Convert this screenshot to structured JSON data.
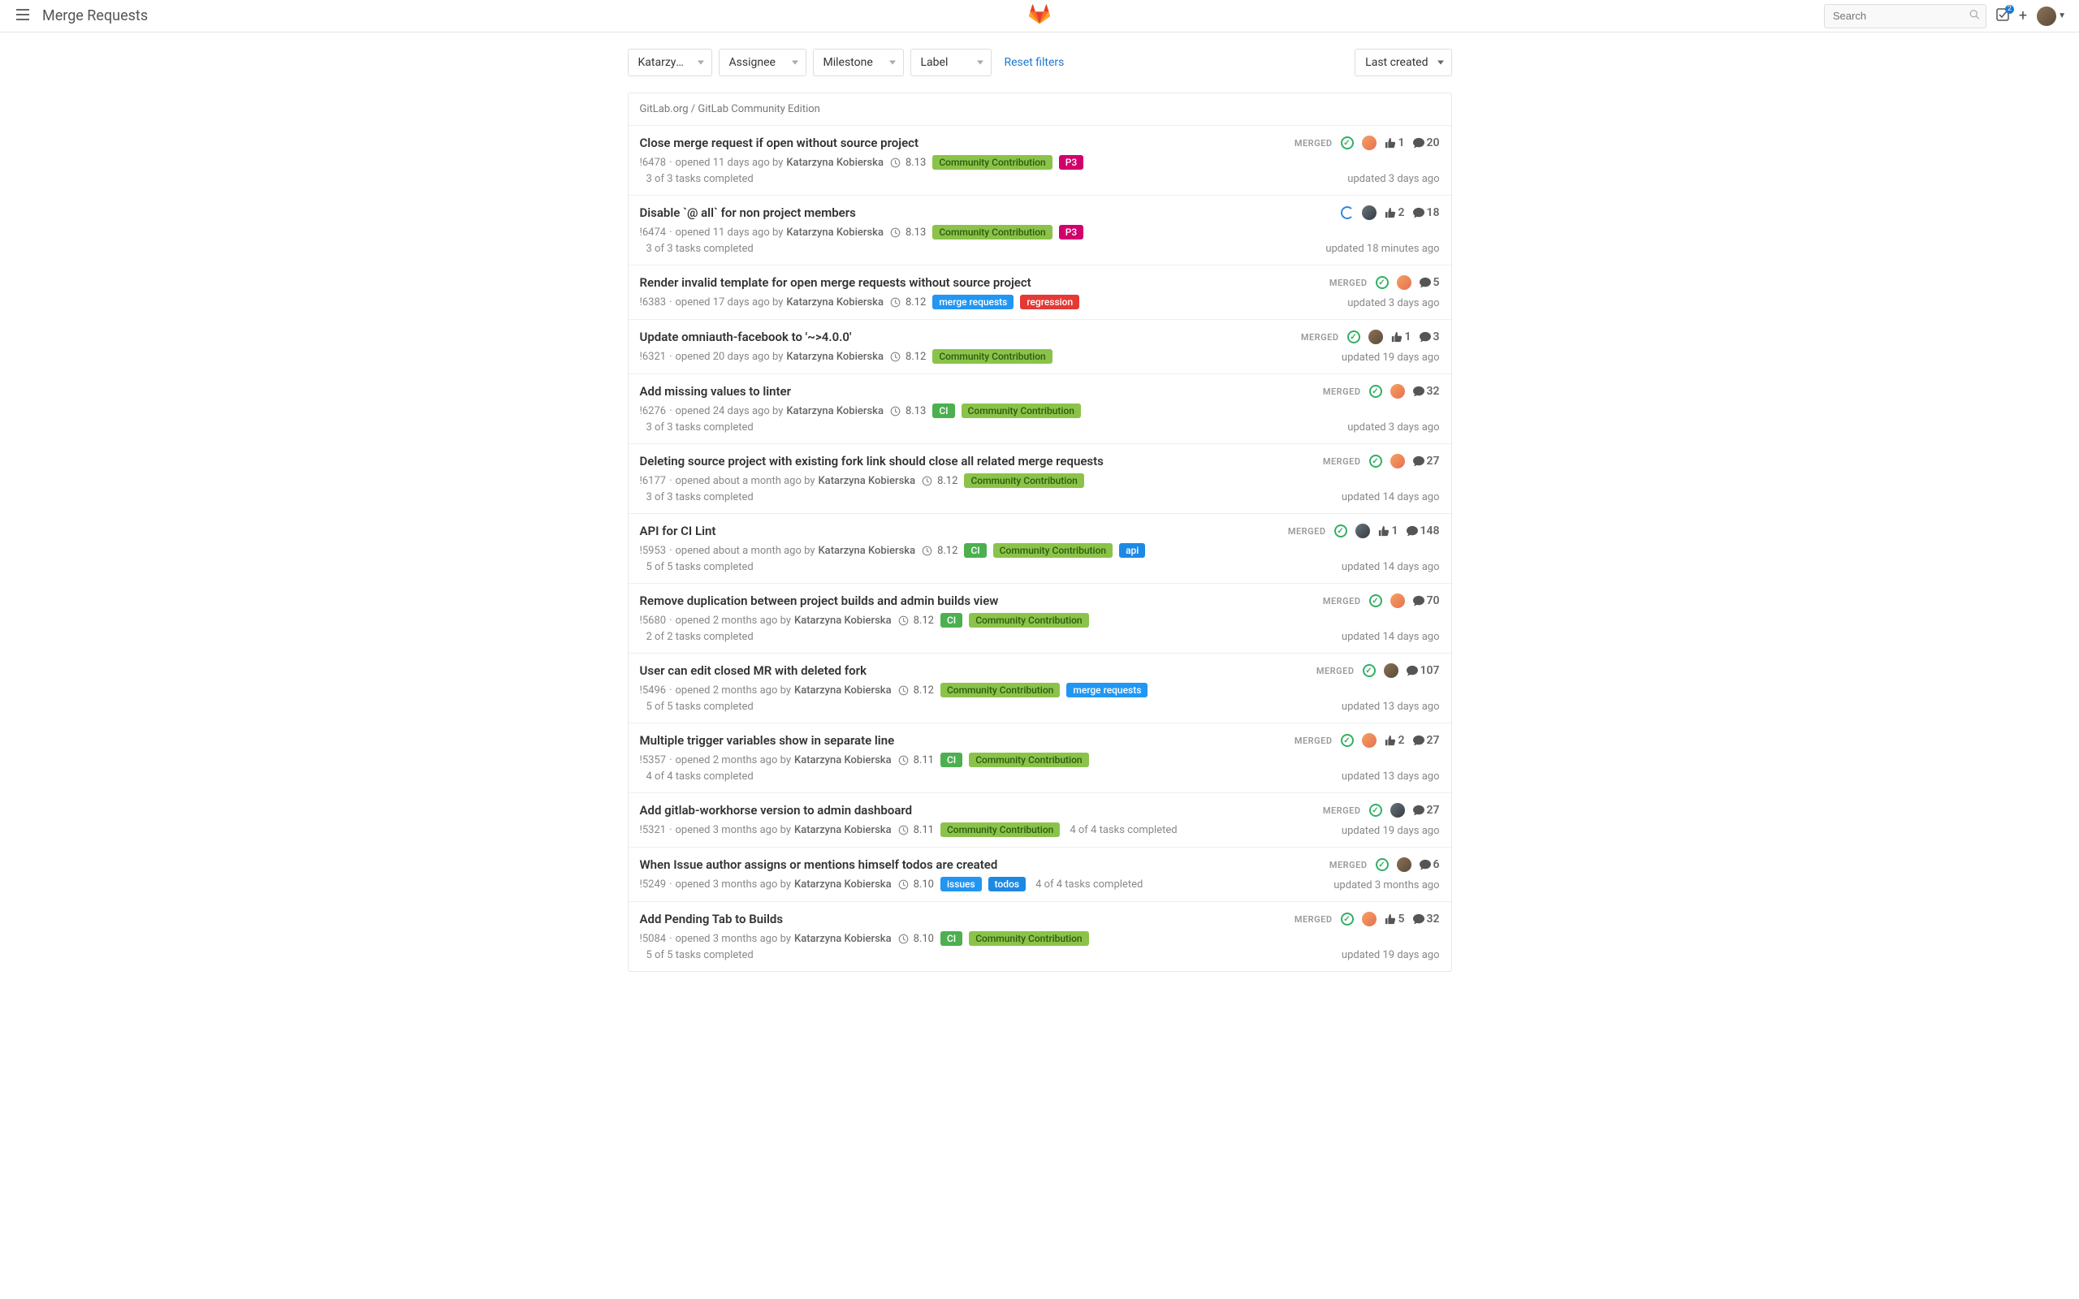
{
  "header": {
    "title": "Merge Requests",
    "search_placeholder": "Search",
    "notification_count": "2"
  },
  "filters": {
    "author": "Katarzyna Ko…",
    "assignee": "Assignee",
    "milestone": "Milestone",
    "label": "Label",
    "reset": "Reset filters",
    "sort": "Last created"
  },
  "project_path": "GitLab.org / GitLab Community Edition",
  "merge_requests": [
    {
      "title": "Close merge request if open without source project",
      "ref": "!6478",
      "opened": "opened 11 days ago by",
      "author": "Katarzyna Kobierska",
      "milestone": "8.13",
      "labels": [
        {
          "t": "Community Contribution",
          "c": "community"
        },
        {
          "t": "P3",
          "c": "p3"
        }
      ],
      "tasks": "3 of 3 tasks completed",
      "updated": "updated 3 days ago",
      "status": "MERGED",
      "ci": "success",
      "avatar": "ava-1",
      "thumbs": "1",
      "comments": "20"
    },
    {
      "title": "Disable `@ all` for non project members",
      "ref": "!6474",
      "opened": "opened 11 days ago by",
      "author": "Katarzyna Kobierska",
      "milestone": "8.13",
      "labels": [
        {
          "t": "Community Contribution",
          "c": "community"
        },
        {
          "t": "P3",
          "c": "p3"
        }
      ],
      "tasks": "3 of 3 tasks completed",
      "updated": "updated 18 minutes ago",
      "status": "",
      "ci": "running",
      "avatar": "ava-2",
      "thumbs": "2",
      "comments": "18"
    },
    {
      "title": "Render invalid template for open merge requests without source project",
      "ref": "!6383",
      "opened": "opened 17 days ago by",
      "author": "Katarzyna Kobierska",
      "milestone": "8.12",
      "labels": [
        {
          "t": "merge requests",
          "c": "merge-requests"
        },
        {
          "t": "regression",
          "c": "regression"
        }
      ],
      "tasks": "",
      "updated": "updated 3 days ago",
      "status": "MERGED",
      "ci": "success",
      "avatar": "ava-1",
      "thumbs": "",
      "comments": "5"
    },
    {
      "title": "Update omniauth-facebook to '~>4.0.0'",
      "ref": "!6321",
      "opened": "opened 20 days ago by",
      "author": "Katarzyna Kobierska",
      "milestone": "8.12",
      "labels": [
        {
          "t": "Community Contribution",
          "c": "community"
        }
      ],
      "tasks": "",
      "updated": "updated 19 days ago",
      "status": "MERGED",
      "ci": "success",
      "avatar": "ava-3",
      "thumbs": "1",
      "comments": "3"
    },
    {
      "title": "Add missing values to linter",
      "ref": "!6276",
      "opened": "opened 24 days ago by",
      "author": "Katarzyna Kobierska",
      "milestone": "8.13",
      "labels": [
        {
          "t": "CI",
          "c": "ci"
        },
        {
          "t": "Community Contribution",
          "c": "community"
        }
      ],
      "tasks": "3 of 3 tasks completed",
      "updated": "updated 3 days ago",
      "status": "MERGED",
      "ci": "success",
      "avatar": "ava-1",
      "thumbs": "",
      "comments": "32"
    },
    {
      "title": "Deleting source project with existing fork link should close all related merge requests",
      "ref": "!6177",
      "opened": "opened about a month ago by",
      "author": "Katarzyna Kobierska",
      "milestone": "8.12",
      "labels": [
        {
          "t": "Community Contribution",
          "c": "community"
        }
      ],
      "tasks": "3 of 3 tasks completed",
      "updated": "updated 14 days ago",
      "status": "MERGED",
      "ci": "success",
      "avatar": "ava-1",
      "thumbs": "",
      "comments": "27"
    },
    {
      "title": "API for CI Lint",
      "ref": "!5953",
      "opened": "opened about a month ago by",
      "author": "Katarzyna Kobierska",
      "milestone": "8.12",
      "labels": [
        {
          "t": "CI",
          "c": "ci"
        },
        {
          "t": "Community Contribution",
          "c": "community"
        },
        {
          "t": "api",
          "c": "api"
        }
      ],
      "tasks": "5 of 5 tasks completed",
      "updated": "updated 14 days ago",
      "status": "MERGED",
      "ci": "success",
      "avatar": "ava-2",
      "thumbs": "1",
      "comments": "148"
    },
    {
      "title": "Remove duplication between project builds and admin builds view",
      "ref": "!5680",
      "opened": "opened 2 months ago by",
      "author": "Katarzyna Kobierska",
      "milestone": "8.12",
      "labels": [
        {
          "t": "CI",
          "c": "ci"
        },
        {
          "t": "Community Contribution",
          "c": "community"
        }
      ],
      "tasks": "2 of 2 tasks completed",
      "updated": "updated 14 days ago",
      "status": "MERGED",
      "ci": "success",
      "avatar": "ava-1",
      "thumbs": "",
      "comments": "70"
    },
    {
      "title": "User can edit closed MR with deleted fork",
      "ref": "!5496",
      "opened": "opened 2 months ago by",
      "author": "Katarzyna Kobierska",
      "milestone": "8.12",
      "labels": [
        {
          "t": "Community Contribution",
          "c": "community"
        },
        {
          "t": "merge requests",
          "c": "merge-requests"
        }
      ],
      "tasks": "5 of 5 tasks completed",
      "updated": "updated 13 days ago",
      "status": "MERGED",
      "ci": "success",
      "avatar": "ava-3",
      "thumbs": "",
      "comments": "107"
    },
    {
      "title": "Multiple trigger variables show in separate line",
      "ref": "!5357",
      "opened": "opened 2 months ago by",
      "author": "Katarzyna Kobierska",
      "milestone": "8.11",
      "labels": [
        {
          "t": "CI",
          "c": "ci"
        },
        {
          "t": "Community Contribution",
          "c": "community"
        }
      ],
      "tasks": "4 of 4 tasks completed",
      "updated": "updated 13 days ago",
      "status": "MERGED",
      "ci": "success",
      "avatar": "ava-1",
      "thumbs": "2",
      "comments": "27"
    },
    {
      "title": "Add gitlab-workhorse version to admin dashboard",
      "ref": "!5321",
      "opened": "opened 3 months ago by",
      "author": "Katarzyna Kobierska",
      "milestone": "8.11",
      "labels": [
        {
          "t": "Community Contribution",
          "c": "community"
        }
      ],
      "tasks": "4 of 4 tasks completed",
      "updated": "updated 19 days ago",
      "status": "MERGED",
      "ci": "success",
      "avatar": "ava-2",
      "thumbs": "",
      "comments": "27"
    },
    {
      "title": "When Issue author assigns or mentions himself todos are created",
      "ref": "!5249",
      "opened": "opened 3 months ago by",
      "author": "Katarzyna Kobierska",
      "milestone": "8.10",
      "labels": [
        {
          "t": "issues",
          "c": "issues"
        },
        {
          "t": "todos",
          "c": "todos"
        }
      ],
      "tasks": "4 of 4 tasks completed",
      "updated": "updated 3 months ago",
      "status": "MERGED",
      "ci": "success",
      "avatar": "ava-3",
      "thumbs": "",
      "comments": "6"
    },
    {
      "title": "Add Pending Tab to Builds",
      "ref": "!5084",
      "opened": "opened 3 months ago by",
      "author": "Katarzyna Kobierska",
      "milestone": "8.10",
      "labels": [
        {
          "t": "CI",
          "c": "ci"
        },
        {
          "t": "Community Contribution",
          "c": "community"
        }
      ],
      "tasks": "5 of 5 tasks completed",
      "updated": "updated 19 days ago",
      "status": "MERGED",
      "ci": "success",
      "avatar": "ava-1",
      "thumbs": "5",
      "comments": "32"
    }
  ]
}
